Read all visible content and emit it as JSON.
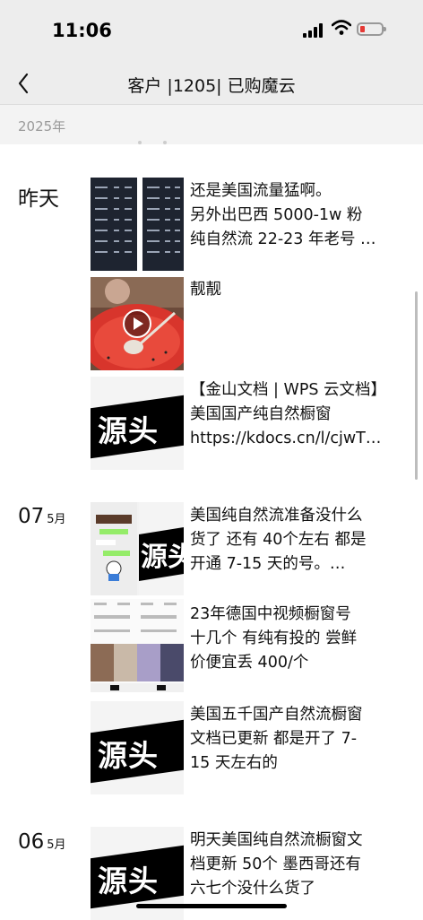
{
  "status": {
    "time": "11:06",
    "battery_color": "#e53935"
  },
  "nav": {
    "title": "客户 |1205| 已购魔云",
    "back_icon": "chevron-left-icon"
  },
  "year_label": "2025年",
  "groups": [
    {
      "date_day": "昨天",
      "date_month": "",
      "posts": [
        {
          "thumb": "spreadsheet-screenshots",
          "lines": [
            "还是美国流量猛啊。",
            "另外出巴西 5000-1w 粉",
            "纯自然流 22-23 年老号 …"
          ]
        },
        {
          "thumb": "video-watermelon",
          "lines": [
            "靓靓"
          ]
        },
        {
          "thumb": "yuantou-logo",
          "logo_text": "源头",
          "lines": [
            "【金山文档 | WPS 云文档】",
            "美国国产纯自然橱窗",
            "https://kdocs.cn/l/cjwT…"
          ]
        }
      ]
    },
    {
      "date_day": "07",
      "date_month": "5月",
      "posts": [
        {
          "thumb": "chat-and-logo",
          "logo_text": "源头",
          "lines": [
            "美国纯自然流准备没什么",
            "货了 还有 40个左右 都是",
            "开通 7-15 天的号。…"
          ]
        },
        {
          "thumb": "profile-screenshots",
          "lines": [
            "23年德国中视频橱窗号",
            "十几个 有纯有投的 尝鲜",
            "价便宜丢 400/个"
          ]
        },
        {
          "thumb": "yuantou-logo",
          "logo_text": "源头",
          "lines": [
            "美国五千国产自然流橱窗",
            "文档已更新 都是开了 7-",
            "15 天左右的"
          ]
        }
      ]
    },
    {
      "date_day": "06",
      "date_month": "5月",
      "posts": [
        {
          "thumb": "yuantou-logo",
          "logo_text": "源头",
          "lines": [
            "明天美国纯自然流橱窗文",
            "档更新 50个 墨西哥还有",
            "六七个没什么货了"
          ]
        }
      ]
    }
  ]
}
